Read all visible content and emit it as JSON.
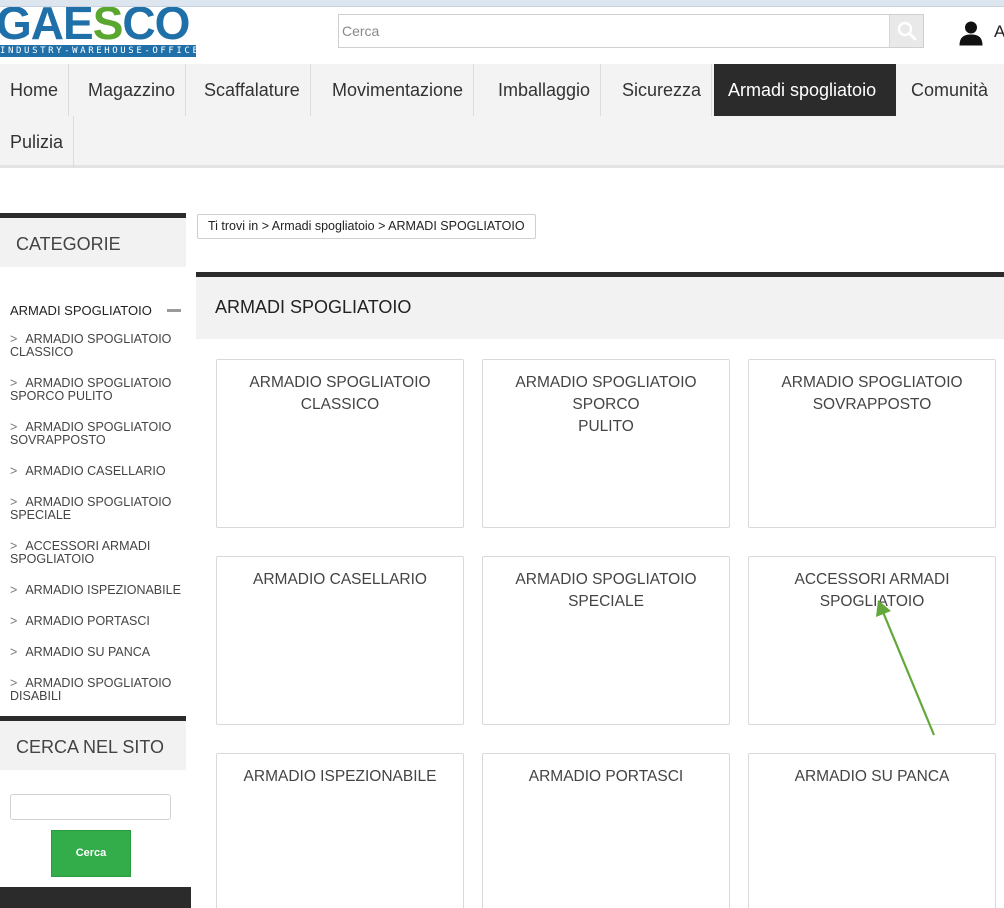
{
  "header": {
    "logo_main": "GAESCO",
    "logo_tagline": "INDUSTRY-WAREHOUSE-OFFICE",
    "search_placeholder": "Cerca",
    "user_label": "A"
  },
  "nav": {
    "items": [
      {
        "label": "Home"
      },
      {
        "label": "Magazzino"
      },
      {
        "label": "Scaffalature"
      },
      {
        "label": "Movimentazione"
      },
      {
        "label": "Imballaggio"
      },
      {
        "label": "Sicurezza"
      },
      {
        "label": "Armadi spogliatoio",
        "active": true
      },
      {
        "label": "Comunità"
      },
      {
        "label": "Pulizia"
      }
    ]
  },
  "sidebar": {
    "categories_title": "CATEGORIE",
    "current_category": "ARMADI SPOGLIATOIO",
    "chevron": ">",
    "items": [
      {
        "line1": "ARMADIO SPOGLIATOIO",
        "line2": "CLASSICO"
      },
      {
        "line1": "ARMADIO SPOGLIATOIO",
        "line2": "SPORCO PULITO"
      },
      {
        "line1": "ARMADIO SPOGLIATOIO",
        "line2": "SOVRAPPOSTO"
      },
      {
        "line1": "ARMADIO CASELLARIO",
        "line2": ""
      },
      {
        "line1": "ARMADIO SPOGLIATOIO",
        "line2": "SPECIALE"
      },
      {
        "line1": "ACCESSORI ARMADI",
        "line2": "SPOGLIATOIO"
      },
      {
        "line1": "ARMADIO ISPEZIONABILE",
        "line2": ""
      },
      {
        "line1": "ARMADIO PORTASCI",
        "line2": ""
      },
      {
        "line1": "ARMADIO SU PANCA",
        "line2": ""
      },
      {
        "line1": "ARMADIO SPOGLIATOIO",
        "line2": "DISABILI"
      }
    ],
    "search_title": "CERCA NEL SITO",
    "search_value": "",
    "search_button": "Cerca"
  },
  "breadcrumb": "Ti trovi in > Armadi spogliatoio > ARMADI SPOGLIATOIO",
  "main": {
    "title": "ARMADI SPOGLIATOIO",
    "products": [
      {
        "line1": "ARMADIO SPOGLIATOIO",
        "line2": "CLASSICO"
      },
      {
        "line1": "ARMADIO SPOGLIATOIO SPORCO",
        "line2": "PULITO"
      },
      {
        "line1": "ARMADIO SPOGLIATOIO",
        "line2": "SOVRAPPOSTO"
      },
      {
        "line1": "ARMADIO CASELLARIO",
        "line2": ""
      },
      {
        "line1": "ARMADIO SPOGLIATOIO SPECIALE",
        "line2": ""
      },
      {
        "line1": "ACCESSORI ARMADI SPOGLIATOIO",
        "line2": ""
      },
      {
        "line1": "ARMADIO ISPEZIONABILE",
        "line2": ""
      },
      {
        "line1": "ARMADIO PORTASCI",
        "line2": ""
      },
      {
        "line1": "ARMADIO SU PANCA",
        "line2": ""
      }
    ]
  },
  "colors": {
    "annotation_arrow": "#62a83a",
    "search_button_green": "#33ad4a",
    "nav_active_bg": "#2b2b2b"
  }
}
